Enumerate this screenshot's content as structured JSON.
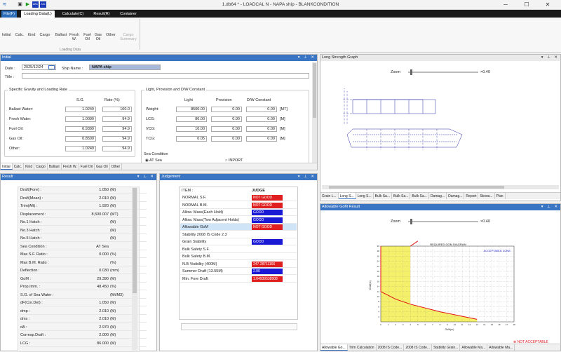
{
  "window": {
    "title": "1.db64 * - LOADCAL N - NAPA ship - BLANKCONDITION",
    "min": "─",
    "max": "☐",
    "close": "✕"
  },
  "quick_icons": {
    "app": "≋",
    "save": "▣",
    "run": "▶",
    "abc1": "ABC",
    "abc2": "Abc"
  },
  "ribbon": {
    "tabs": [
      "File(F)",
      "Loading Data(L)",
      "Calculate(C)",
      "Result(R)",
      "Container"
    ],
    "buttons": [
      {
        "label": "Initial"
      },
      {
        "label": "Calc."
      },
      {
        "label": "Kind"
      },
      {
        "label": "Cargo"
      },
      {
        "label": "Ballast"
      },
      {
        "label": "Fresh W."
      },
      {
        "label": "Fuel Oil"
      },
      {
        "label": "Gas Oil"
      },
      {
        "label": "Other"
      },
      {
        "label": "Cargo Summary"
      }
    ],
    "group": "Loading Data"
  },
  "initial": {
    "title": "Initial",
    "date_label": "Date :",
    "date_value": "2025/12/24",
    "ship_name_label": "Ship Name :",
    "ship_name_value": "NAPA ship",
    "title_label": "Title :",
    "title_value": "",
    "sg": {
      "title": "Specific Gravity and Loading Rate",
      "h_sg": "S.G.",
      "h_rate": "Rate  (%)",
      "rows": [
        {
          "name": "Ballast Water:",
          "sg": "1.0249",
          "rate": "100.0"
        },
        {
          "name": "Fresh Water:",
          "sg": "1.0000",
          "rate": "94.9"
        },
        {
          "name": "Fuel Oil:",
          "sg": "0.9399",
          "rate": "94.9"
        },
        {
          "name": "Gas Oil:",
          "sg": "0.8500",
          "rate": "94.9"
        },
        {
          "name": "Other:",
          "sg": "1.0249",
          "rate": "94.9"
        }
      ]
    },
    "light": {
      "title": "Light, Provision and D/W Constant",
      "h_light": "Light",
      "h_prov": "Provision",
      "h_dw": "D/W Constant",
      "rows": [
        {
          "name": "Weight:",
          "light": "8500.00",
          "prov": "0.00",
          "dw": "0.00",
          "unit": "[MT]"
        },
        {
          "name": "LCG:",
          "light": "86.00",
          "prov": "0.00",
          "dw": "0.00",
          "unit": "[M]"
        },
        {
          "name": "VCG:",
          "light": "10.00",
          "prov": "0.00",
          "dw": "0.00",
          "unit": "[M]"
        },
        {
          "name": "TCG:",
          "light": "0.05",
          "prov": "0.00",
          "dw": "0.00",
          "unit": "[M]"
        }
      ]
    },
    "sea": {
      "title": "Sea Condition",
      "opt1": "AT Sea",
      "opt2": "INPORT"
    },
    "tabs": [
      "Initial",
      "Calc.",
      "Kind",
      "Cargo",
      "Ballast",
      "Fresh W.",
      "Fuel Oil",
      "Gas Oil",
      "Other"
    ]
  },
  "result": {
    "title": "Result",
    "rows": [
      {
        "k": "Draft(Fore) :",
        "v": "1.050",
        "u": "(M)"
      },
      {
        "k": "Draft(Mean) :",
        "v": "2.010",
        "u": "(M)"
      },
      {
        "k": "Trim(Aft) :",
        "v": "1.920",
        "u": "(M)"
      },
      {
        "k": "Displacement :",
        "v": "8,500.007",
        "u": "(MT)"
      },
      {
        "k": "No.1 Hatch :",
        "v": "",
        "u": "(M)"
      },
      {
        "k": "No.3 Hatch :",
        "v": "",
        "u": "(M)"
      },
      {
        "k": "No.5 Hatch :",
        "v": "",
        "u": "(M)"
      },
      {
        "k": "Sea Condition :",
        "v": "AT Sea",
        "u": ""
      },
      {
        "k": "Max S.F. Ratio :",
        "v": "0.000",
        "u": "(%)"
      },
      {
        "k": "Max B.M. Ratio :",
        "v": "",
        "u": "(%)"
      },
      {
        "k": "Deflection :",
        "v": "0.030",
        "u": "(mm)"
      },
      {
        "k": "GoM :",
        "v": "29.390",
        "u": "(M)"
      },
      {
        "k": "Prop.Imm. :",
        "v": "48.450",
        "u": "(%)"
      },
      {
        "k": "S.G. of Sea Water :",
        "v": "",
        "u": "(Mt/M3)"
      },
      {
        "k": "dF(Cor.Det) :",
        "v": "1.050",
        "u": "(M)"
      },
      {
        "k": "dmp :",
        "v": "2.010",
        "u": "(M)"
      },
      {
        "k": "dms :",
        "v": "2.010",
        "u": "(M)"
      },
      {
        "k": "dA :",
        "v": "2.970",
        "u": "(M)"
      },
      {
        "k": "Corresp.Draft :",
        "v": "2.000",
        "u": "(M)"
      },
      {
        "k": "LCG :",
        "v": "86.000",
        "u": "(M)"
      }
    ]
  },
  "judgement": {
    "title": "Judgement",
    "h_item": "ITEM :",
    "h_judge": "JUDGE",
    "rows": [
      {
        "k": "NORMAL S.F.",
        "j": "NOT GOOD",
        "c": "#e02020"
      },
      {
        "k": "NORMAL B.M.",
        "j": "NOT GOOD",
        "c": "#e02020"
      },
      {
        "k": "Allow. Mass(Each Hold)",
        "j": "GOOD",
        "c": "#1a1ad6"
      },
      {
        "k": "Allow. Mass(Two Adjacent Holds)",
        "j": "GOOD",
        "c": "#1a1ad6"
      },
      {
        "k": "Allowable GoM",
        "j": "NOT GOOD",
        "c": "#e02020"
      },
      {
        "k": "Stability 2008 IS Code 2.3",
        "j": "",
        "c": "#ffffff"
      },
      {
        "k": "Grain Stability",
        "j": "GOOD",
        "c": "#1a1ad6"
      },
      {
        "k": "Bulk Safety S.F.",
        "j": "",
        "c": "#ffffff"
      },
      {
        "k": "Bulk Safety B.M.",
        "j": "",
        "c": "#ffffff"
      },
      {
        "k": "N.B Visibility (400M)",
        "j": "247.28711166",
        "c": "#e02020"
      },
      {
        "k": "Summer Draft (13.55M)",
        "j": "2.00",
        "c": "#1a1ad6"
      },
      {
        "k": "Min. Fore Draft",
        "j": "1.04939538908",
        "c": "#e02020"
      }
    ]
  },
  "long": {
    "title": "Long Strength Graph",
    "zoom_label": "Zoom",
    "zoom_value": "×0.40",
    "tabs": [
      "Grain L...",
      "Long S...",
      "Long S...",
      "Bulk Sa...",
      "Bulk Sa...",
      "Bulk Sa...",
      "Damag...",
      "Damag...",
      "Report",
      "Stowa...",
      "Plan"
    ]
  },
  "gom": {
    "title": "Allowable GoM Result",
    "zoom_label": "Zoom",
    "zoom_value": "×0.40",
    "chart_title": "REQUIRED GOM DIAGRAM",
    "acceptable": "ACCEPTABLE ZONE",
    "not_acceptable": "NOT ACCEPTABLE",
    "ylabel": "Draft(m)",
    "xlabel": "GoM(m)",
    "tabs": [
      "Allowable Go...",
      "Trim Calculation",
      "2008 IS Code...",
      "2008 IS Code...",
      "Stability Grain...",
      "Allowable Ma...",
      "Allowable Ma..."
    ]
  },
  "chart_data": {
    "type": "area",
    "title": "REQUIRED GOM DIAGRAM",
    "xlabel": "GoM(m)",
    "ylabel": "Draft(m)",
    "x": [
      0,
      1,
      2,
      3,
      4,
      5,
      6,
      7,
      8,
      9,
      10,
      11,
      12,
      13,
      14,
      15,
      16,
      17,
      18
    ],
    "y_ticks": [
      2,
      4,
      6,
      8,
      10,
      12,
      14,
      16,
      18,
      20,
      22,
      24,
      26,
      28,
      30
    ],
    "series": [
      {
        "name": "ACCEPTABLE ZONE",
        "upper_boundary": [
          [
            0,
            30
          ],
          [
            4,
            30
          ]
        ],
        "lower_boundary": [
          [
            0,
            12
          ],
          [
            2,
            9
          ],
          [
            4,
            7
          ],
          [
            8,
            4
          ],
          [
            13,
            1
          ]
        ]
      }
    ],
    "xlim": [
      0,
      18
    ],
    "ylim": [
      0,
      30
    ],
    "grid": true
  }
}
